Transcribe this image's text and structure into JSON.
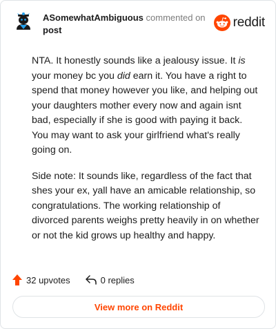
{
  "comment": {
    "author": "ASomewhatAmbiguous",
    "action_text": "commented on",
    "post_link_label": "post",
    "paragraphs": [
      [
        {
          "text": "NTA. It honestly sounds like a jealousy issue. It ",
          "italic": false
        },
        {
          "text": "is",
          "italic": true
        },
        {
          "text": " your money bc you ",
          "italic": false
        },
        {
          "text": "did",
          "italic": true
        },
        {
          "text": " earn it. You have a right to spend that money however you like, and helping out your daughters mother every now and again isnt bad, especially if she is good with paying it back. You may want to ask your girlfriend what's really going on.",
          "italic": false
        }
      ],
      [
        {
          "text": "Side note: It sounds like, regardless of the fact that shes your ex, yall have an amicable relationship, so congratulations. The working relationship of divorced parents weighs pretty heavily in on whether or not the kid grows up healthy and happy.",
          "italic": false
        }
      ]
    ]
  },
  "brand": {
    "name": "reddit",
    "icon": "reddit-snoo-icon",
    "color": "#ff4500"
  },
  "actions": {
    "upvotes_label": "32 upvotes",
    "replies_label": "0 replies"
  },
  "footer": {
    "view_more_label": "View more on Reddit"
  },
  "colors": {
    "accent": "#ff4500",
    "border": "#dfe3e6",
    "muted": "#7c7c7c",
    "avatar": "#24a0ed"
  }
}
